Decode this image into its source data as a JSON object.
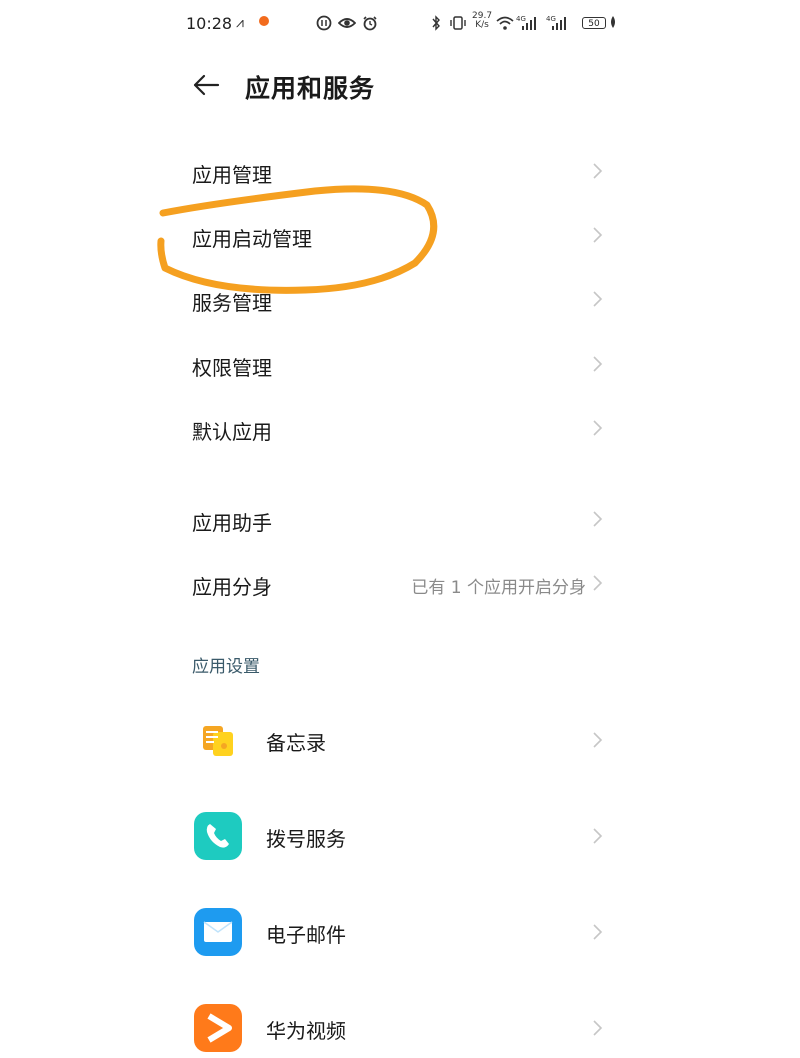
{
  "status_bar": {
    "time": "10:28",
    "network_speed_value": "29.7",
    "network_speed_unit": "K/s",
    "signal_1_label": "4G",
    "signal_2_label": "4G",
    "battery": "50"
  },
  "header": {
    "title": "应用和服务"
  },
  "menu": {
    "items": [
      {
        "label": "应用管理"
      },
      {
        "label": "应用启动管理"
      },
      {
        "label": "服务管理"
      },
      {
        "label": "权限管理"
      },
      {
        "label": "默认应用"
      },
      {
        "label": "应用助手"
      },
      {
        "label": "应用分身",
        "value": "已有 1 个应用开启分身"
      }
    ]
  },
  "app_settings": {
    "section_title": "应用设置",
    "apps": [
      {
        "label": "备忘录",
        "icon": "memo-icon",
        "color": "#F5A623"
      },
      {
        "label": "拨号服务",
        "icon": "phone-icon",
        "color": "#1ECBC0"
      },
      {
        "label": "电子邮件",
        "icon": "email-icon",
        "color": "#1E9BF0"
      },
      {
        "label": "华为视频",
        "icon": "video-icon",
        "color": "#FF7A1A"
      }
    ]
  },
  "colors": {
    "annotation_circle": "#F5A020",
    "secondary_text": "#8a8a8a",
    "chevron": "#c6c6c6"
  }
}
